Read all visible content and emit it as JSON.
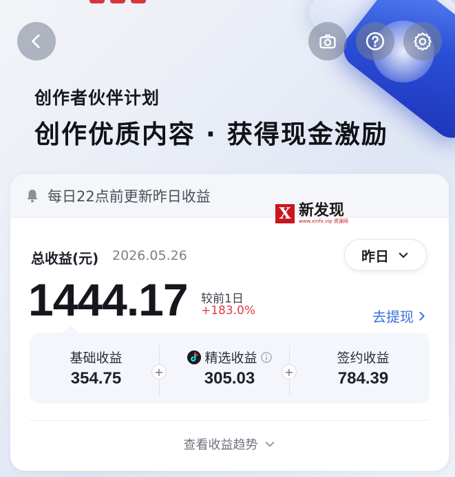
{
  "colors": {
    "accent_blue": "#3b6fe0",
    "increase_red": "#e5374a",
    "text_dark": "#15171c",
    "muted": "#7b7f89"
  },
  "header": {
    "back_icon": "chevron-left-icon",
    "camera_icon": "camera-icon",
    "help_icon": "question-circle-icon",
    "settings_icon": "gear-icon"
  },
  "hero": {
    "subtitle": "创作者伙伴计划",
    "title": "创作优质内容 · 获得现金激励"
  },
  "notice": {
    "text": "每日22点前更新昨日收益",
    "icon": "bell-icon"
  },
  "watermark": {
    "logo_letter": "X",
    "main": "新发现",
    "sub": "www.xinfx.vip 资源网"
  },
  "summary": {
    "label": "总收益(元)",
    "date": "2026.05.26",
    "period": "昨日",
    "total": "1444.17",
    "compare_label": "较前1日",
    "compare_value": "+183.0%",
    "withdraw": "去提现"
  },
  "breakdown": [
    {
      "label": "基础收益",
      "value": "354.75"
    },
    {
      "label": "精选收益",
      "value": "305.03"
    },
    {
      "label": "签约收益",
      "value": "784.39"
    }
  ],
  "footer": {
    "trend": "查看收益趋势"
  }
}
